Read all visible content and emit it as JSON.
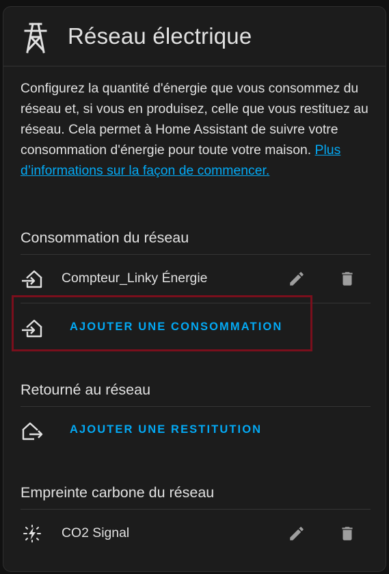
{
  "header": {
    "title": "Réseau électrique",
    "icon": "transmission-tower-icon"
  },
  "description": {
    "text": "Configurez la quantité d'énergie que vous consommez du réseau et, si vous en produisez, celle que vous restituez au réseau. Cela permet à Home Assistant de suivre votre consommation d'énergie pour toute votre maison. ",
    "link_text": "Plus d’informations sur la façon de commencer."
  },
  "consumption": {
    "title": "Consommation du réseau",
    "items": [
      {
        "label": "Compteur_Linky Énergie",
        "icon": "transmission-tower-import-icon"
      }
    ],
    "add_label": "AJOUTER UNE CONSOMMATION"
  },
  "return": {
    "title": "Retourné au réseau",
    "add_label": "AJOUTER UNE RESTITUTION"
  },
  "carbon": {
    "title": "Empreinte carbone du réseau",
    "items": [
      {
        "label": "CO2 Signal",
        "icon": "leaf-lightning-icon"
      }
    ]
  },
  "colors": {
    "accent": "#03a9f4",
    "card_background": "#1c1c1c",
    "text": "#e1e1e1",
    "icon_muted": "#9e9e9e",
    "highlight_border": "#7a0f1c"
  }
}
